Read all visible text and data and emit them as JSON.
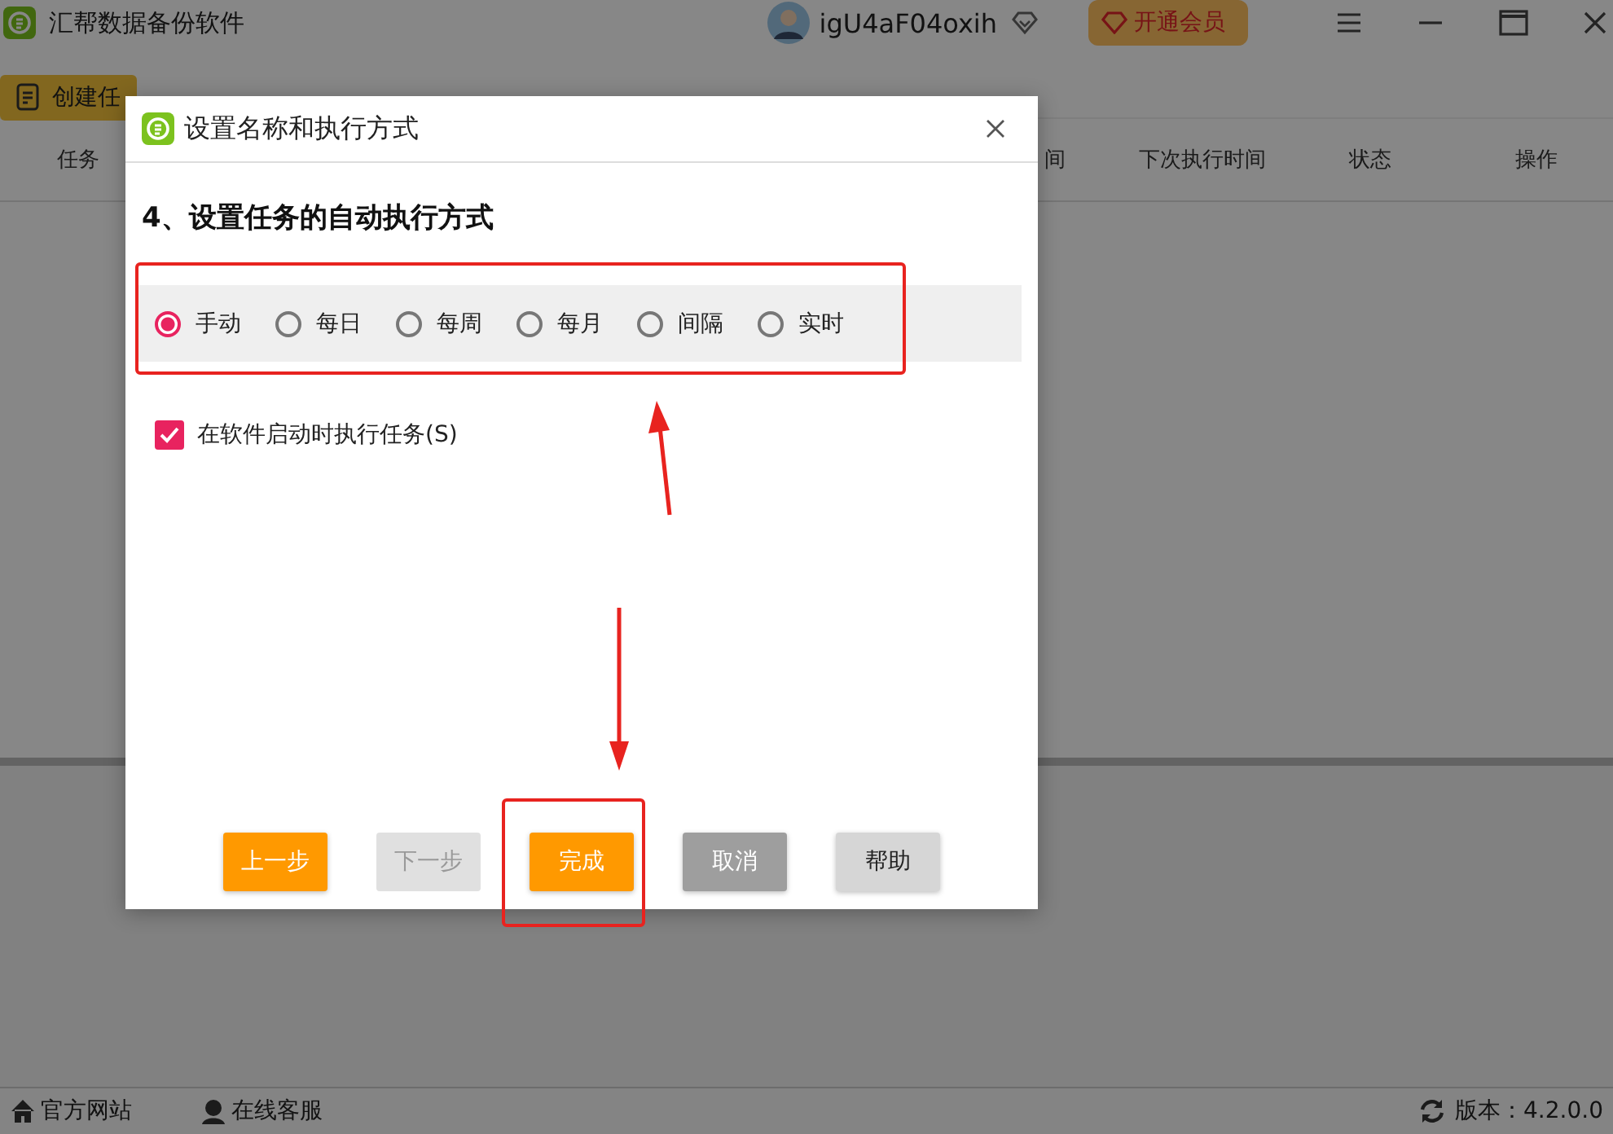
{
  "app": {
    "title": "汇帮数据备份软件",
    "user": "igU4aF04oxih",
    "vip_button": "开通会员"
  },
  "toolbar": {
    "create_button": "创建任"
  },
  "table": {
    "columns": [
      "任务",
      "间",
      "下次执行时间",
      "状态",
      "操作"
    ]
  },
  "status_bar": {
    "links": [
      "官方网站",
      "在线客服"
    ],
    "version": "版本：4.2.0.0"
  },
  "dialog": {
    "title": "设置名称和执行方式",
    "heading": "4、设置任务的自动执行方式",
    "modes": [
      {
        "label": "手动",
        "selected": true
      },
      {
        "label": "每日",
        "selected": false
      },
      {
        "label": "每周",
        "selected": false
      },
      {
        "label": "每月",
        "selected": false
      },
      {
        "label": "间隔",
        "selected": false
      },
      {
        "label": "实时",
        "selected": false
      }
    ],
    "startup_option": {
      "label": "在软件启动时执行任务(S)",
      "checked": true
    },
    "buttons": [
      {
        "label": "上一步",
        "kind": "primary"
      },
      {
        "label": "下一步",
        "kind": "disabled"
      },
      {
        "label": "完成",
        "kind": "primary"
      },
      {
        "label": "取消",
        "kind": "dark"
      },
      {
        "label": "帮助",
        "kind": "light"
      }
    ]
  }
}
